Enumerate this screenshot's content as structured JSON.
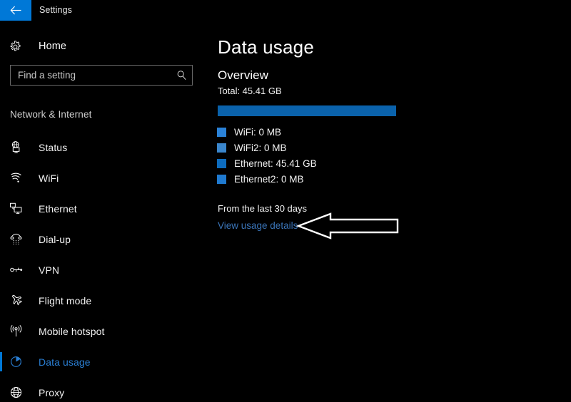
{
  "titlebar": {
    "back_label": "Back",
    "back_icon": "arrow-left-icon",
    "title": "Settings",
    "accent_color": "#0078d7"
  },
  "sidebar": {
    "home": {
      "label": "Home",
      "icon": "gear-icon"
    },
    "search": {
      "value": "",
      "placeholder": "Find a setting",
      "icon": "search-icon"
    },
    "section_header": "Network & Internet",
    "items": [
      {
        "label": "Status",
        "icon": "globe-monitor-icon",
        "selected": false
      },
      {
        "label": "WiFi",
        "icon": "wifi-icon",
        "selected": false
      },
      {
        "label": "Ethernet",
        "icon": "ethernet-icon",
        "selected": false
      },
      {
        "label": "Dial-up",
        "icon": "dialup-phone-icon",
        "selected": false
      },
      {
        "label": "VPN",
        "icon": "vpn-key-icon",
        "selected": false
      },
      {
        "label": "Flight mode",
        "icon": "airplane-icon",
        "selected": false
      },
      {
        "label": "Mobile hotspot",
        "icon": "hotspot-broadcast-icon",
        "selected": false
      },
      {
        "label": "Data usage",
        "icon": "pie-chart-icon",
        "selected": true
      },
      {
        "label": "Proxy",
        "icon": "globe-icon",
        "selected": false
      }
    ],
    "selected_accent": "#0078d7",
    "selected_text_color": "#2a7fd4"
  },
  "main": {
    "page_title": "Data usage",
    "overview_title": "Overview",
    "total_text": "Total: 45.41 GB",
    "legend": [
      {
        "label": "WiFi: 0 MB",
        "color": "#2a82d8",
        "share": 0
      },
      {
        "label": "WiFi2: 0 MB",
        "color": "#3a86cc",
        "share": 0
      },
      {
        "label": "Ethernet: 45.41 GB",
        "color": "#0d6cbe",
        "share": 100
      },
      {
        "label": "Ethernet2: 0 MB",
        "color": "#1f7ad0",
        "share": 0
      }
    ],
    "period_text": "From the last 30 days",
    "details_link": "View usage details",
    "bar_color": "#0a62ab"
  },
  "annotation": {
    "arrow": "left-pointing-arrow-annotation",
    "color": "#ffffff"
  }
}
